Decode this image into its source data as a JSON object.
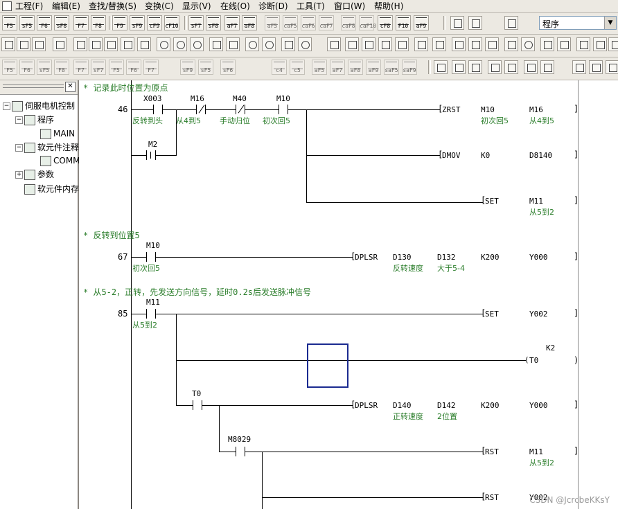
{
  "menubar": {
    "items": [
      "工程(F)",
      "编辑(E)",
      "查找/替换(S)",
      "变换(C)",
      "显示(V)",
      "在线(O)",
      "诊断(D)",
      "工具(T)",
      "窗口(W)",
      "帮助(H)"
    ]
  },
  "toolbar1": {
    "keys": [
      "F5",
      "sF5",
      "F6",
      "sF6",
      "F7",
      "F8",
      "F9",
      "sF9",
      "cF9",
      "cF10",
      "sF7",
      "sF8",
      "aF7",
      "aF8",
      "aF5",
      "caF5",
      "caF6",
      "caF7",
      "caF8",
      "caF10",
      "cF8",
      "caF9",
      "caF10",
      "F10",
      "aF9"
    ]
  },
  "combo": {
    "value": "程序"
  },
  "toolbar3": {
    "keys": [
      "F5",
      "F6",
      "sF5",
      "F8",
      "F7",
      "sF7",
      "F5",
      "F6",
      "F7",
      "sF9",
      "sF5",
      "sF6",
      "c4",
      "c5",
      "aF5",
      "aF7",
      "aF8",
      "aF9",
      "saF5",
      "saF9"
    ]
  },
  "tree": {
    "root": "伺服电机控制",
    "program": "程序",
    "main": "MAIN",
    "devcomment": "软元件注释",
    "comment": "COMMENT",
    "param": "参数",
    "devmem": "软元件内存"
  },
  "ladder": {
    "comments": [
      "* 记录此时位置为原点",
      "* 反转到位置5",
      "* 从5-2，正转，先发送方向信号，延时0.2s后发送脉冲信号"
    ],
    "steps": [
      "46",
      "67",
      "85"
    ],
    "devices": {
      "x003": "X003",
      "m16": "M16",
      "m40": "M40",
      "m10a": "M10",
      "m2": "M2",
      "m10b": "M10",
      "m11": "M11",
      "t0": "T0",
      "m8029": "M8029"
    },
    "device_comments": {
      "x003": "反转到头",
      "m16": "从4到5",
      "m40": "手动归位",
      "m10a": "初次回5",
      "m10b": "初次回5",
      "m11": "从5到2"
    },
    "instructions": [
      {
        "op": "ZRST",
        "a1": "M10",
        "a2": "M16",
        "c1": "初次回5",
        "c2": "从4到5"
      },
      {
        "op": "DMOV",
        "a1": "K0",
        "a2": "D8140"
      },
      {
        "op": "SET",
        "a1": "M11",
        "c1": "从5到2"
      },
      {
        "op": "DPLSR",
        "a1": "D130",
        "a2": "D132",
        "a3": "K200",
        "a4": "Y000",
        "c1": "反转速度",
        "c2": "大于5-4"
      },
      {
        "op": "SET",
        "a1": "Y002"
      },
      {
        "op": "T0",
        "a1": "K2"
      },
      {
        "op": "DPLSR",
        "a1": "D140",
        "a2": "D142",
        "a3": "K200",
        "a4": "Y000",
        "c1": "正转速度",
        "c2": "2位置"
      },
      {
        "op": "RST",
        "a1": "M11",
        "c1": "从5到2"
      },
      {
        "op": "RST",
        "a1": "Y002"
      }
    ]
  },
  "watermark": "CSDN @JcrcbeKKsY"
}
